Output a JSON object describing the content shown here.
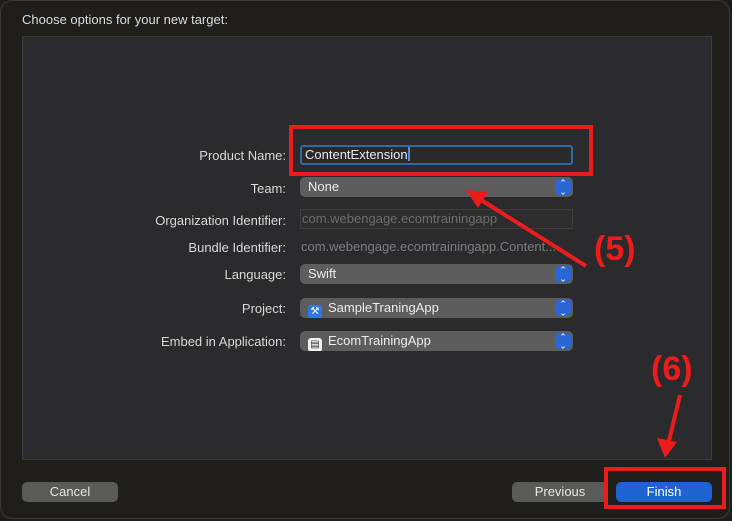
{
  "dialog": {
    "title": "Choose options for your new target:"
  },
  "form": {
    "product_name": {
      "label": "Product Name:",
      "value": "ContentExtension"
    },
    "team": {
      "label": "Team:",
      "value": "None"
    },
    "organization_identifier": {
      "label": "Organization Identifier:",
      "placeholder": "com.webengage.ecomtrainingapp"
    },
    "bundle_identifier": {
      "label": "Bundle Identifier:",
      "value": "com.webengage.ecomtrainingapp.Content..."
    },
    "language": {
      "label": "Language:",
      "value": "Swift"
    },
    "project": {
      "label": "Project:",
      "value": "SampleTraningApp",
      "icon": "xcode-project-icon"
    },
    "embed_in_application": {
      "label": "Embed in Application:",
      "value": "EcomTrainingApp",
      "icon": "app-icon"
    }
  },
  "buttons": {
    "cancel": "Cancel",
    "previous": "Previous",
    "finish": "Finish"
  },
  "annotations": {
    "step5": "(5)",
    "step6": "(6)",
    "color": "#ec1c1c"
  },
  "colors": {
    "accent": "#2a66d6",
    "primary_button": "#1f62d3",
    "focus_ring": "#2f6aa3"
  }
}
